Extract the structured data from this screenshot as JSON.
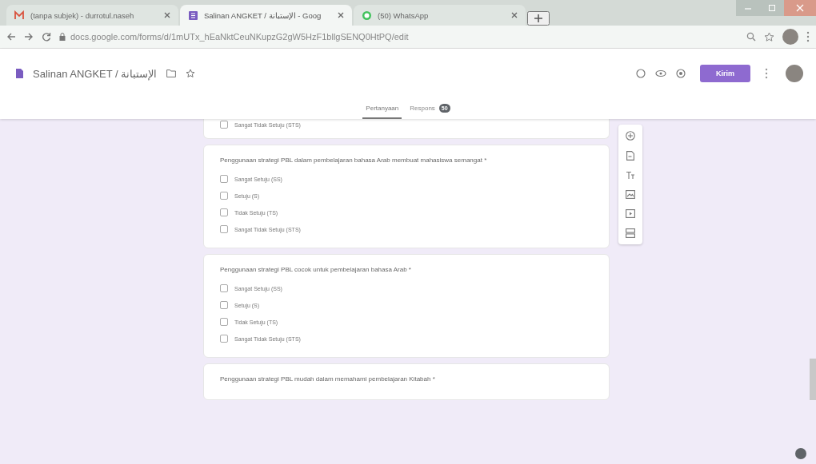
{
  "browser": {
    "tabs": [
      {
        "kind": "mail",
        "title": "(tanpa subjek) - durrotul.naseh",
        "selected": false
      },
      {
        "kind": "forms",
        "title": "Salinan ANGKET / الإستبانة - Goog",
        "selected": true
      },
      {
        "kind": "chat",
        "title": "(50) WhatsApp",
        "selected": false
      }
    ],
    "url": "docs.google.com/forms/d/1mUTx_hEaNktCeuNKupzG2gW5HzF1bllgSENQ0HtPQ/edit"
  },
  "form": {
    "title": "Salinan ANGKET / الإستبانة",
    "send_button": "Kirim",
    "tabs": [
      {
        "label": "Pertanyaan",
        "selected": true
      },
      {
        "label": "Respons",
        "selected": false,
        "badge": "50"
      }
    ]
  },
  "partial_question": {
    "options": [
      {
        "label": "Sangat Tidak Setuju (STS)",
        "checked": false
      }
    ]
  },
  "questions": [
    {
      "title": "Penggunaan strategi PBL dalam pembelajaran bahasa Arab membuat mahasiswa semangat *",
      "options": [
        {
          "label": "Sangat Setuju (SS)",
          "checked": false
        },
        {
          "label": "Setuju (S)",
          "checked": false
        },
        {
          "label": "Tidak Setuju (TS)",
          "checked": false
        },
        {
          "label": "Sangat Tidak Setuju (STS)",
          "checked": false
        }
      ]
    },
    {
      "title": "Penggunaan strategi PBL cocok untuk pembelajaran bahasa Arab *",
      "options": [
        {
          "label": "Sangat Setuju (SS)",
          "checked": false
        },
        {
          "label": "Setuju (S)",
          "checked": false
        },
        {
          "label": "Tidak Setuju (TS)",
          "checked": false
        },
        {
          "label": "Sangat Tidak Setuju (STS)",
          "checked": false
        }
      ]
    },
    {
      "title": "Penggunaan strategi PBL mudah dalam memahami pembelajaran Kitabah *"
    }
  ]
}
